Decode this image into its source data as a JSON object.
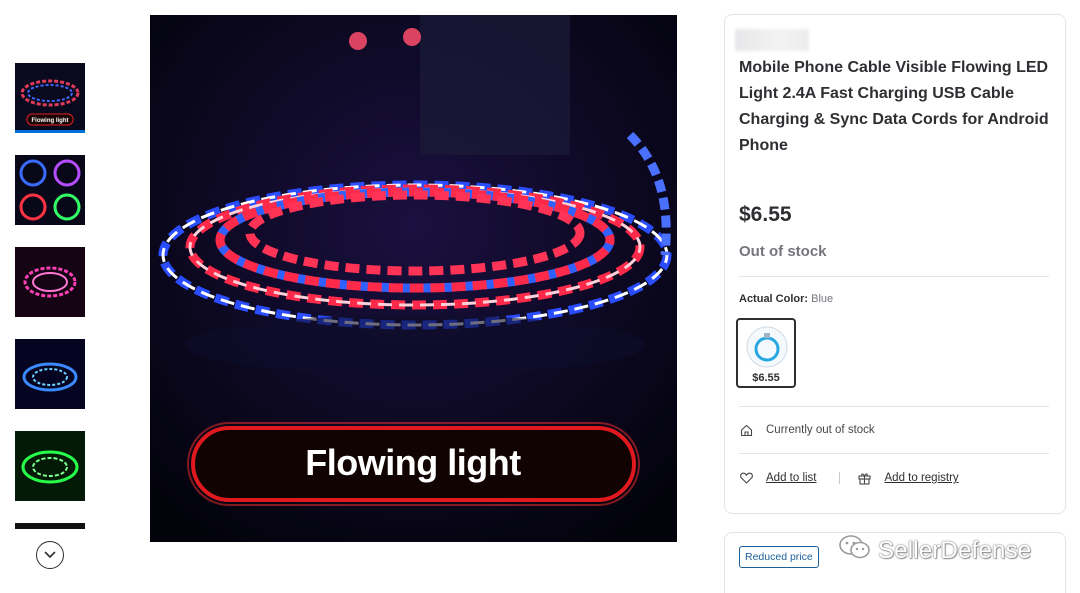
{
  "product": {
    "title": "Mobile Phone Cable Visible Flowing LED Light 2.4A Fast Charging USB Cable Charging & Sync Data Cords for Android Phone",
    "price": "$6.55",
    "stock_status": "Out of stock",
    "main_image_caption": "Flowing light",
    "thumb_caption": "Flowing light"
  },
  "variant": {
    "label": "Actual Color:",
    "value": "Blue",
    "swatch_price": "$6.55"
  },
  "fulfillment": {
    "status_text": "Currently out of stock"
  },
  "actions": {
    "add_to_list": "Add to list",
    "add_to_registry": "Add to registry"
  },
  "offer": {
    "badge": "Reduced price"
  },
  "watermark": {
    "text": "SellerDefense"
  },
  "colors": {
    "text": "#2e2f32",
    "muted": "#74767c",
    "accent": "#0071dc",
    "badge": "#1d5f99"
  },
  "icons": {
    "scroll_down": "chevron-down-icon",
    "fulfillment": "home-icon",
    "list": "heart-icon",
    "registry": "gift-icon"
  }
}
